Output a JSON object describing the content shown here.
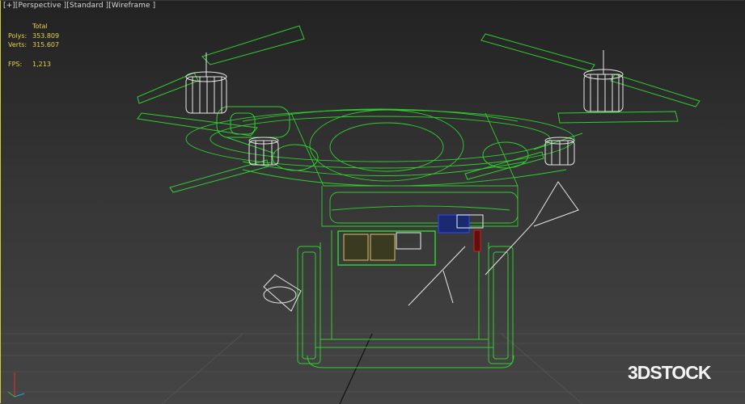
{
  "viewport": {
    "label_plus": "[+]",
    "label_view": "[Perspective ]",
    "label_shading": "[Standard ]",
    "label_mode": "[Wireframe ]"
  },
  "stats": {
    "header": "Total",
    "polys_label": "Polys:",
    "polys_value": "353.809",
    "verts_label": "Verts:",
    "verts_value": "315.607",
    "fps_label": "FPS:",
    "fps_value": "1,213"
  },
  "watermark": "3DSTOCK",
  "colors": {
    "wire_green": "#2fcf2f",
    "stats_yellow": "#e6d24a",
    "motor_white": "#e8e8e8",
    "component_blue": "#2a3fd6",
    "component_red": "#d02020"
  }
}
